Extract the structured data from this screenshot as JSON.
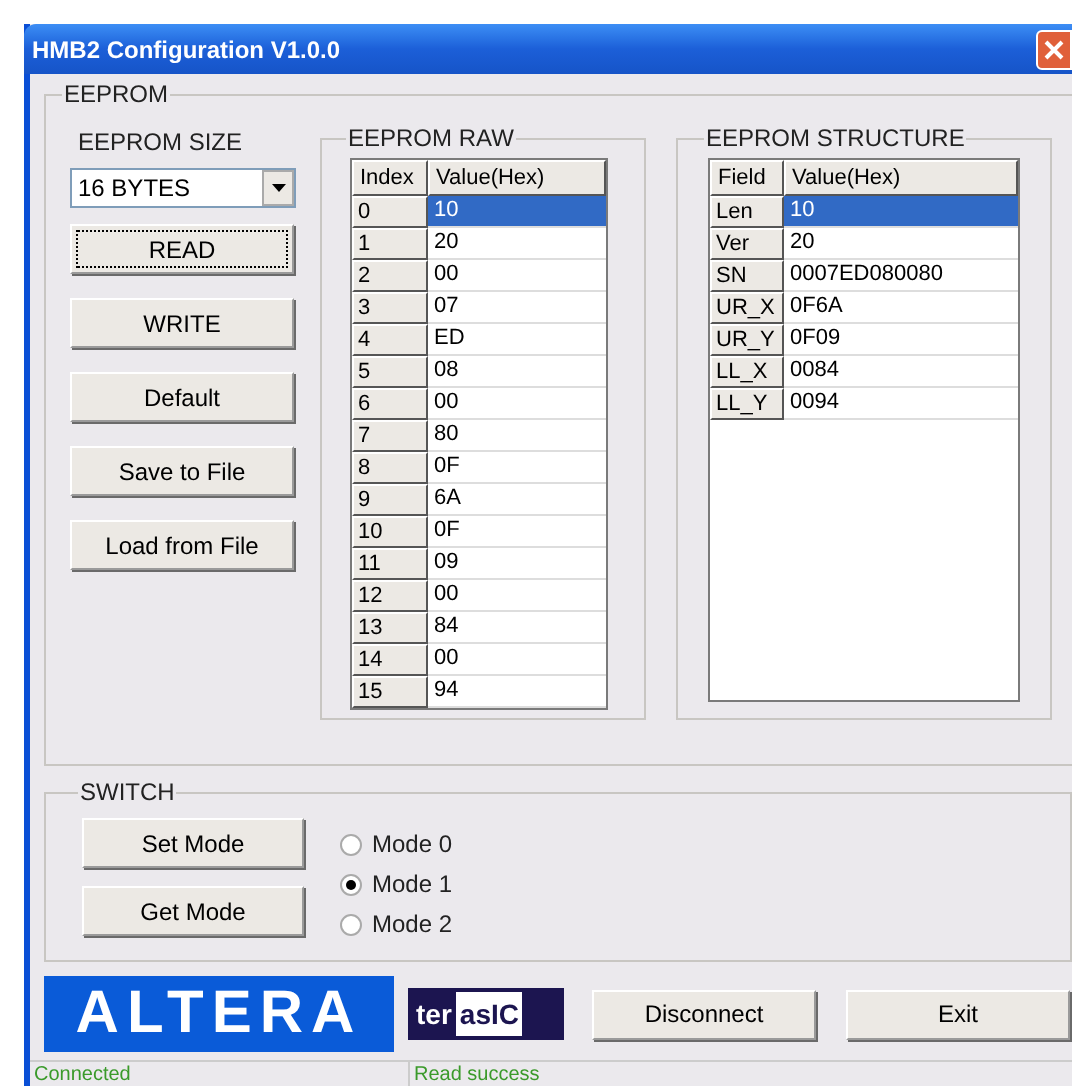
{
  "window": {
    "title": "HMB2 Configuration V1.0.0"
  },
  "eeprom": {
    "title": "EEPROM",
    "size": {
      "label": "EEPROM SIZE",
      "value": "16 BYTES"
    },
    "buttons": [
      {
        "label": "READ",
        "focused": true
      },
      {
        "label": "WRITE",
        "focused": false
      },
      {
        "label": "Default",
        "focused": false
      },
      {
        "label": "Save to File",
        "focused": false
      },
      {
        "label": "Load from File",
        "focused": false
      }
    ],
    "raw": {
      "title": "EEPROM RAW",
      "columns": [
        "Index",
        "Value(Hex)"
      ],
      "rows": [
        {
          "index": "0",
          "value": "10",
          "selected": true
        },
        {
          "index": "1",
          "value": "20",
          "selected": false
        },
        {
          "index": "2",
          "value": "00",
          "selected": false
        },
        {
          "index": "3",
          "value": "07",
          "selected": false
        },
        {
          "index": "4",
          "value": "ED",
          "selected": false
        },
        {
          "index": "5",
          "value": "08",
          "selected": false
        },
        {
          "index": "6",
          "value": "00",
          "selected": false
        },
        {
          "index": "7",
          "value": "80",
          "selected": false
        },
        {
          "index": "8",
          "value": "0F",
          "selected": false
        },
        {
          "index": "9",
          "value": "6A",
          "selected": false
        },
        {
          "index": "10",
          "value": "0F",
          "selected": false
        },
        {
          "index": "11",
          "value": "09",
          "selected": false
        },
        {
          "index": "12",
          "value": "00",
          "selected": false
        },
        {
          "index": "13",
          "value": "84",
          "selected": false
        },
        {
          "index": "14",
          "value": "00",
          "selected": false
        },
        {
          "index": "15",
          "value": "94",
          "selected": false
        }
      ]
    },
    "structure": {
      "title": "EEPROM STRUCTURE",
      "columns": [
        "Field",
        "Value(Hex)"
      ],
      "rows": [
        {
          "field": "Len",
          "value": "10",
          "selected": true
        },
        {
          "field": "Ver",
          "value": "20",
          "selected": false
        },
        {
          "field": "SN",
          "value": "0007ED080080",
          "selected": false
        },
        {
          "field": "UR_X",
          "value": "0F6A",
          "selected": false
        },
        {
          "field": "UR_Y",
          "value": "0F09",
          "selected": false
        },
        {
          "field": "LL_X",
          "value": "0084",
          "selected": false
        },
        {
          "field": "LL_Y",
          "value": "0094",
          "selected": false
        }
      ]
    }
  },
  "switch": {
    "title": "SWITCH",
    "buttons": [
      "Set Mode",
      "Get Mode"
    ],
    "modes": [
      {
        "label": "Mode 0",
        "selected": false
      },
      {
        "label": "Mode 1",
        "selected": true
      },
      {
        "label": "Mode 2",
        "selected": false
      }
    ]
  },
  "logos": {
    "altera": "ALTERA",
    "terasic_dark": "ter",
    "terasic_light": "asIC"
  },
  "actions": [
    "Disconnect",
    "Exit"
  ],
  "status_bar": [
    "Connected",
    "Read success"
  ]
}
